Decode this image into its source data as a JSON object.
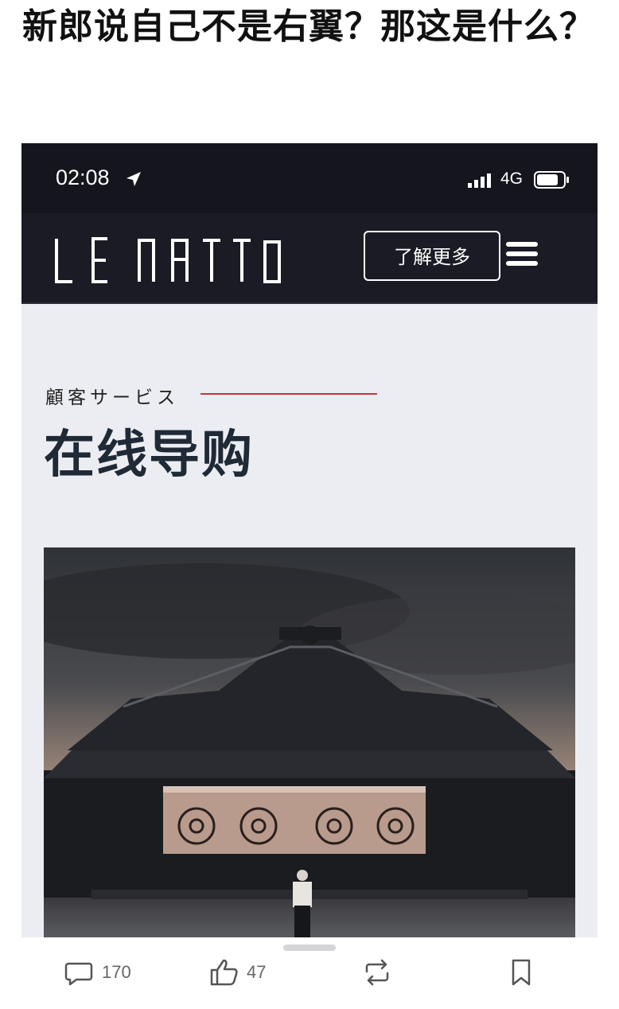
{
  "post": {
    "title": "新郎说自己不是右翼？那这是什么？"
  },
  "phone": {
    "status": {
      "time": "02:08",
      "network": "4G"
    },
    "nav": {
      "logo_text": "LE NATTO",
      "learn_more": "了解更多"
    },
    "section": {
      "label": "顧客サービス",
      "heading": "在线导购"
    },
    "colors": {
      "header_bg": "#1a1b25",
      "page_bg": "#ecedf3",
      "accent_line": "#c8333a",
      "heading": "#1f2a36"
    }
  },
  "actions": {
    "comments": "170",
    "likes": "47",
    "repost_icon": "repost-icon",
    "bookmark_icon": "bookmark-icon"
  }
}
